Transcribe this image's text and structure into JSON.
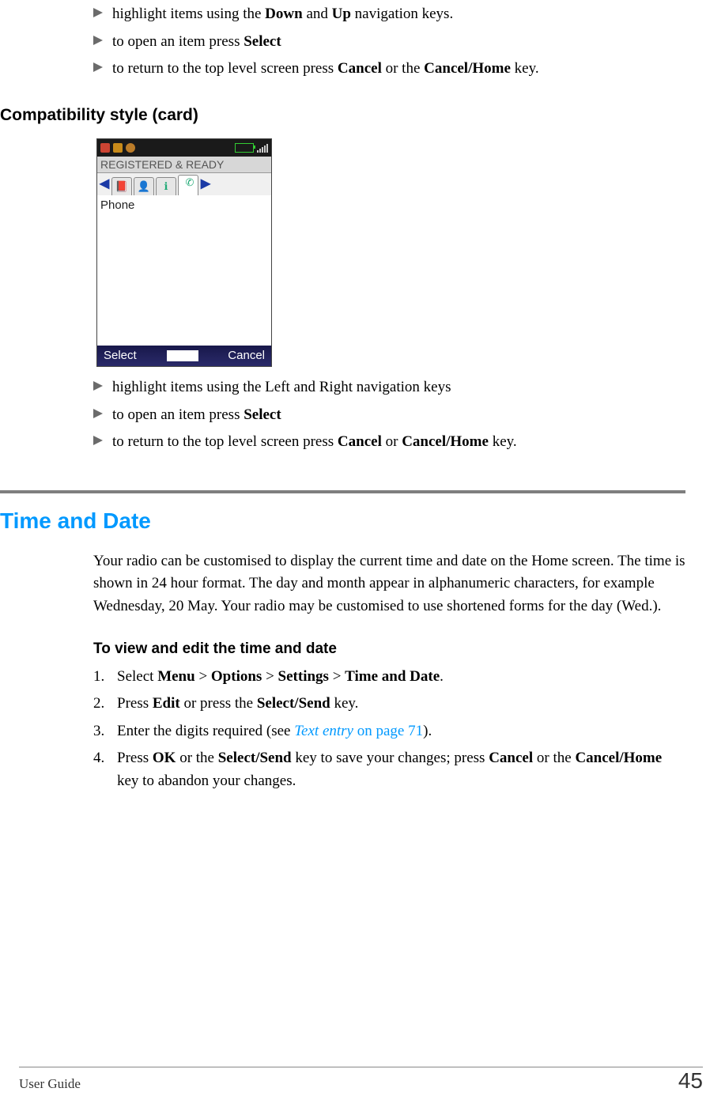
{
  "list1": {
    "item0": {
      "pre": "highlight items using the ",
      "b1": "Down",
      "mid": " and ",
      "b2": "Up",
      "post": " navigation keys."
    },
    "item1": {
      "pre": "to open an item press ",
      "b1": "Select"
    },
    "item2": {
      "pre": "to return to the top level screen press ",
      "b1": "Cancel",
      "mid": " or the ",
      "b2": "Cancel/Home",
      "post": " key."
    }
  },
  "h2_compat": "Compatibility style (card)",
  "phone": {
    "status_text": "REGISTERED & READY",
    "body_label": "Phone",
    "softkey_left": "Select",
    "softkey_right": "Cancel"
  },
  "list2": {
    "item0": "highlight items using the Left and Right navigation keys",
    "item1": {
      "pre": "to open an item press ",
      "b1": "Select"
    },
    "item2": {
      "pre": "to return to the top level screen press ",
      "b1": "Cancel",
      "mid": " or ",
      "b2": "Cancel/Home",
      "post": " key."
    }
  },
  "section_title": "Time and Date",
  "intro_para": "Your radio can be customised to display the current time and date on the Home screen. The time is shown in 24 hour format. The day and month appear in alphanumeric characters, for example Wednesday, 20 May. Your radio may be customised to use shortened forms for the day (Wed.).",
  "h3": "To view and edit the time and date",
  "steps": {
    "s1": {
      "pre": "Select ",
      "b1": "Menu",
      "gt1": " > ",
      "b2": "Options",
      "gt2": " > ",
      "b3": "Settings",
      "gt3": " > ",
      "b4": "Time and Date",
      "post": "."
    },
    "s2": {
      "pre": "Press ",
      "b1": "Edit",
      "mid": " or press the ",
      "b2": "Select/Send",
      "post": " key."
    },
    "s3": {
      "pre": "Enter the digits required (see ",
      "link_text": "Text entry",
      "link_page": " on page 71",
      "post": ")."
    },
    "s4": {
      "pre": "Press ",
      "b1": "OK",
      "m1": " or the ",
      "b2": "Select/Send",
      "m2": " key to save your changes; press ",
      "b3": "Cancel",
      "m3": " or the ",
      "b4": "Cancel/Home",
      "post": " key to abandon your changes."
    }
  },
  "footer": {
    "label": "User Guide",
    "page": "45"
  }
}
